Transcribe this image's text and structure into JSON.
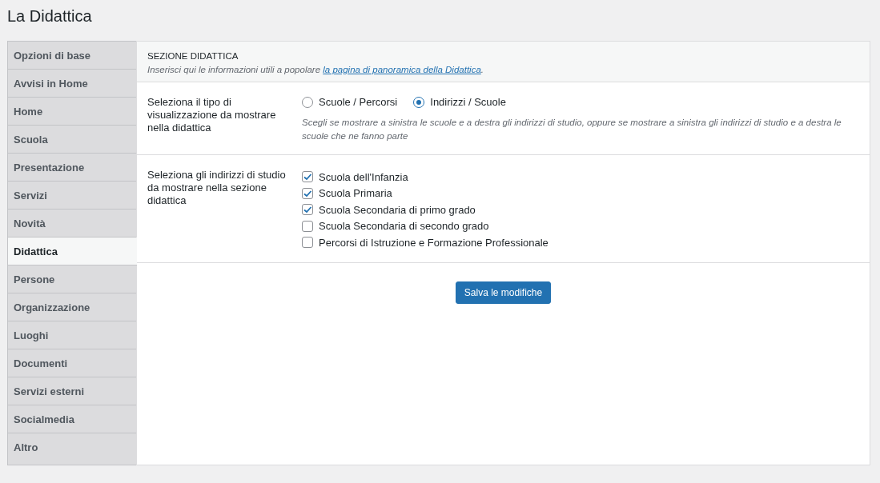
{
  "page_title": "La Didattica",
  "sidebar": {
    "items": [
      {
        "label": "Opzioni di base",
        "selected": false
      },
      {
        "label": "Avvisi in Home",
        "selected": false
      },
      {
        "label": "Home",
        "selected": false
      },
      {
        "label": "Scuola",
        "selected": false
      },
      {
        "label": "Presentazione",
        "selected": false
      },
      {
        "label": "Servizi",
        "selected": false
      },
      {
        "label": "Novità",
        "selected": false
      },
      {
        "label": "Didattica",
        "selected": true
      },
      {
        "label": "Persone",
        "selected": false
      },
      {
        "label": "Organizzazione",
        "selected": false
      },
      {
        "label": "Luoghi",
        "selected": false
      },
      {
        "label": "Documenti",
        "selected": false
      },
      {
        "label": "Servizi esterni",
        "selected": false
      },
      {
        "label": "Socialmedia",
        "selected": false
      },
      {
        "label": "Altro",
        "selected": false
      }
    ]
  },
  "section": {
    "heading": "SEZIONE DIDATTICA",
    "description_before": "Inserisci qui le informazioni utili a popolare ",
    "description_link": "la pagina di panoramica della Didattica",
    "description_after": "."
  },
  "fields": [
    {
      "kind": "radio",
      "label": "Seleziona il tipo di visualizzazione da mostrare nella didattica",
      "options": [
        {
          "label": "Scuole / Percorsi",
          "selected": false
        },
        {
          "label": "Indirizzi / Scuole",
          "selected": true
        }
      ],
      "help": "Scegli se mostrare a sinistra le scuole e a destra gli indirizzi di studio, oppure se mostrare a sinistra gli indirizzi di studio e a destra le scuole che ne fanno parte"
    },
    {
      "kind": "checkbox",
      "label": "Seleziona gli indirizzi di studio da mostrare nella sezione didattica",
      "options": [
        {
          "label": "Scuola dell'Infanzia",
          "checked": true
        },
        {
          "label": "Scuola Primaria",
          "checked": true
        },
        {
          "label": "Scuola Secondaria di primo grado",
          "checked": true
        },
        {
          "label": "Scuola Secondaria di secondo grado",
          "checked": false
        },
        {
          "label": "Percorsi di Istruzione e Formazione Professionale",
          "checked": false
        }
      ]
    }
  ],
  "save_button": "Salva le modifiche"
}
